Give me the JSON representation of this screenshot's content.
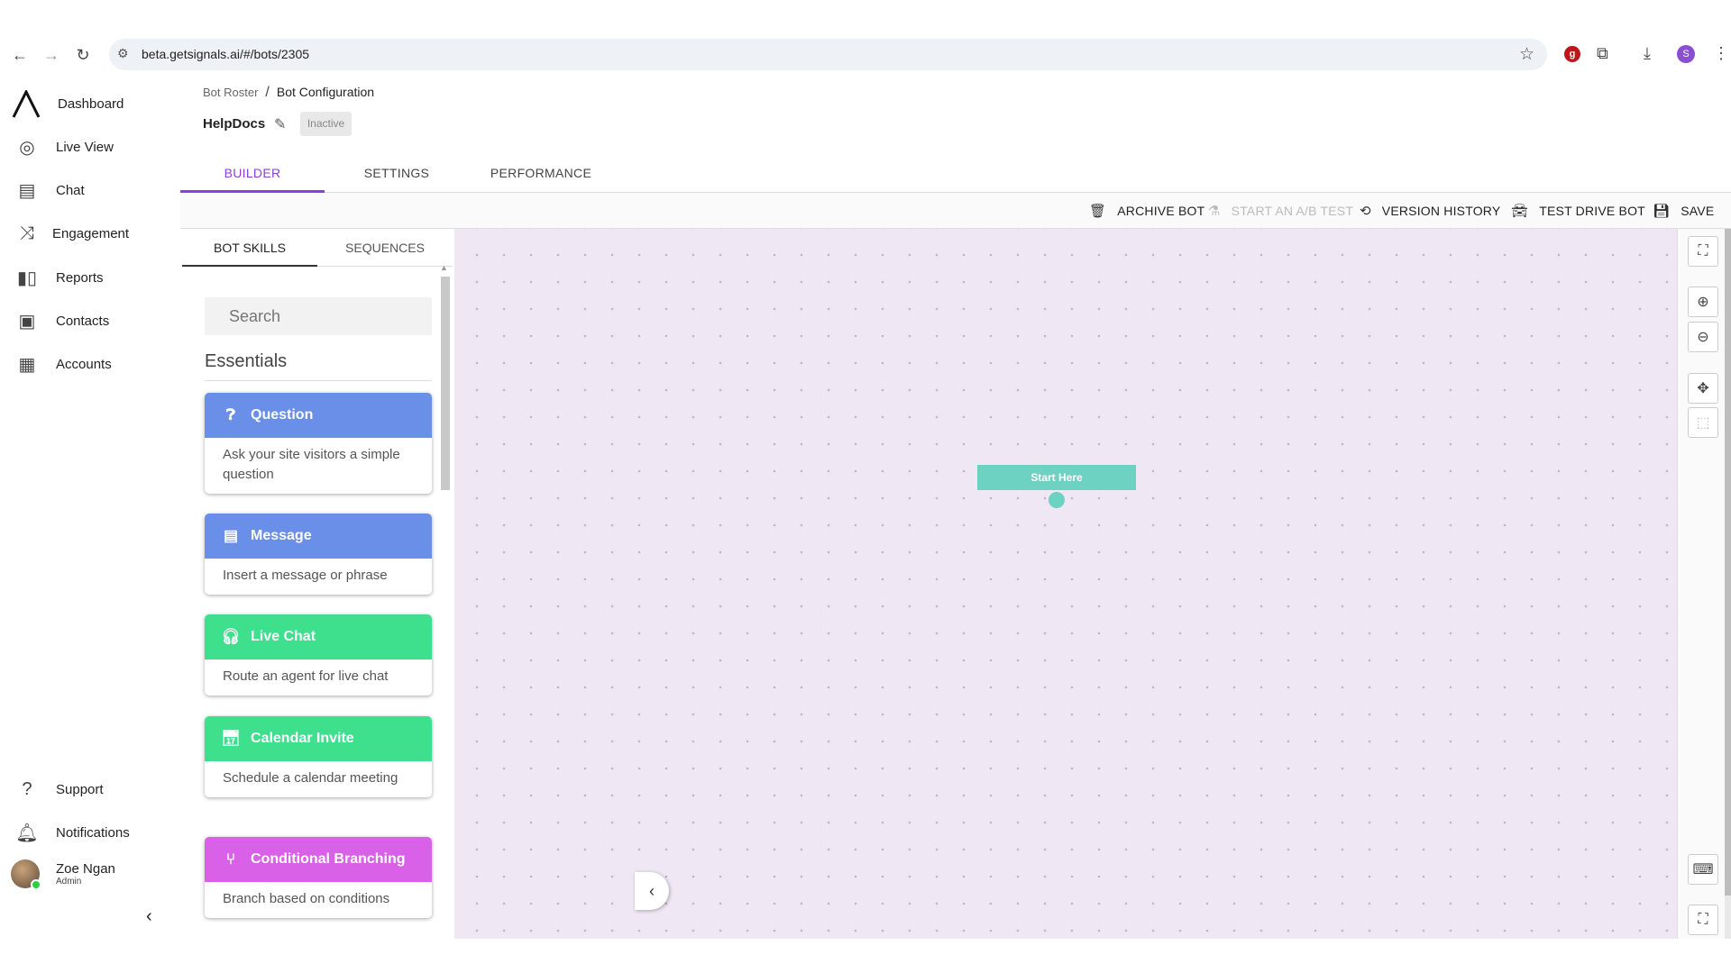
{
  "browser": {
    "url": "beta.getsignals.ai/#/bots/2305",
    "profile_initial": "S",
    "ext_badge": "g"
  },
  "sidebar": {
    "items": [
      {
        "label": "Dashboard",
        "icon": "logo-icon"
      },
      {
        "label": "Live View",
        "icon": "live-view-icon"
      },
      {
        "label": "Chat",
        "icon": "chat-icon"
      },
      {
        "label": "Engagement",
        "icon": "engagement-icon"
      },
      {
        "label": "Reports",
        "icon": "bar-chart-icon"
      },
      {
        "label": "Contacts",
        "icon": "contacts-icon"
      },
      {
        "label": "Accounts",
        "icon": "building-icon"
      }
    ],
    "bottom": [
      {
        "label": "Support",
        "icon": "help-icon"
      },
      {
        "label": "Notifications",
        "icon": "bell-icon"
      }
    ],
    "user": {
      "name": "Zoe Ngan",
      "role": "Admin"
    }
  },
  "header": {
    "breadcrumb": [
      "Bot Roster",
      "Bot Configuration"
    ],
    "bot_name": "HelpDocs",
    "status": "Inactive"
  },
  "tabs": [
    "BUILDER",
    "SETTINGS",
    "PERFORMANCE"
  ],
  "toolbar": {
    "archive": "ARCHIVE BOT",
    "ab_test": "START AN A/B TEST",
    "version_history": "VERSION HISTORY",
    "test_drive": "TEST DRIVE BOT",
    "save": "SAVE"
  },
  "panel": {
    "tabs": [
      "BOT SKILLS",
      "SEQUENCES"
    ],
    "search_placeholder": "Search",
    "section": "Essentials",
    "skills": [
      {
        "title": "Question",
        "desc": "Ask your site visitors a simple question",
        "color": "#6a8fe8"
      },
      {
        "title": "Message",
        "desc": "Insert a message or phrase",
        "color": "#6a8fe8"
      },
      {
        "title": "Live Chat",
        "desc": "Route an agent for live chat",
        "color": "#3ee08e"
      },
      {
        "title": "Calendar Invite",
        "desc": "Schedule a calendar meeting",
        "color": "#3ee08e"
      },
      {
        "title": "Conditional Branching",
        "desc": "Branch based on conditions",
        "color": "#d961e8"
      }
    ]
  },
  "canvas": {
    "start_label": "Start Here"
  },
  "colors": {
    "accent": "#8b3fd8",
    "canvas_bg": "#f0e7f5",
    "start_node": "#6ed2c3"
  }
}
